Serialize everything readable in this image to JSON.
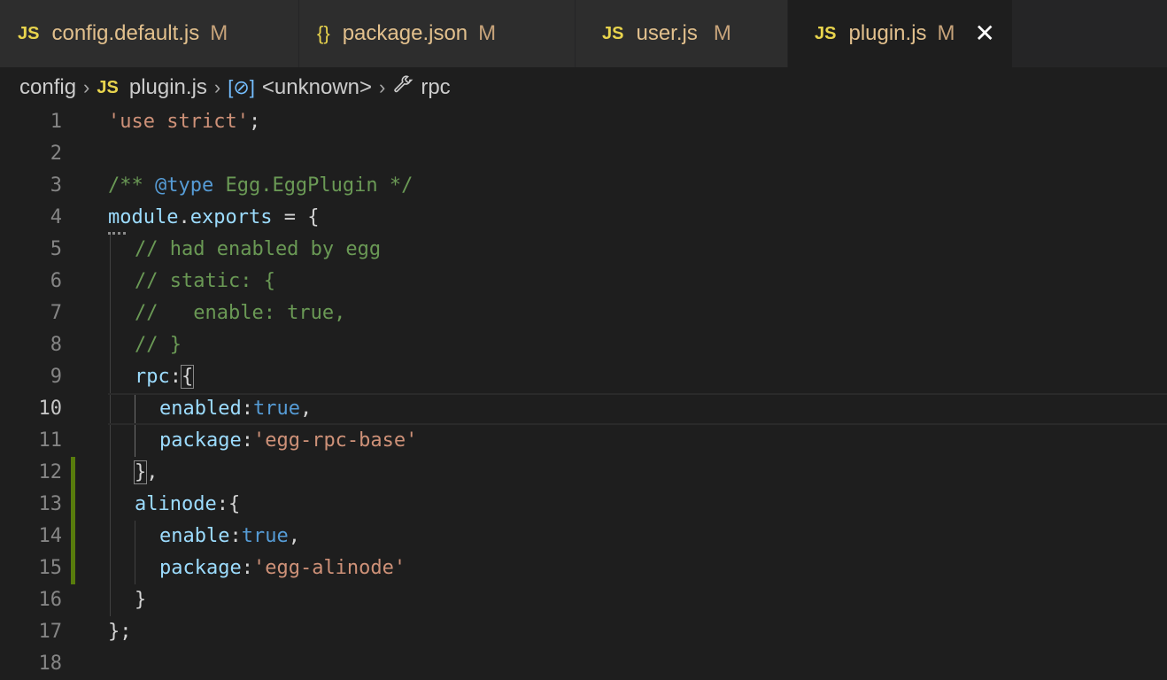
{
  "tabs": [
    {
      "icon": "JS",
      "name": "config.default.js",
      "modified": "M"
    },
    {
      "icon": "{}",
      "name": "package.json",
      "modified": "M"
    },
    {
      "icon": "JS",
      "name": "user.js",
      "modified": "M"
    },
    {
      "icon": "JS",
      "name": "plugin.js",
      "modified": "M",
      "close": "✕"
    }
  ],
  "breadcrumb": {
    "folder": "config",
    "file_icon": "JS",
    "file": "plugin.js",
    "symbol": "<unknown>",
    "member": "rpc"
  },
  "editor": {
    "line_numbers": [
      "1",
      "2",
      "3",
      "4",
      "5",
      "6",
      "7",
      "8",
      "9",
      "10",
      "11",
      "12",
      "13",
      "14",
      "15",
      "16",
      "17",
      "18"
    ],
    "active_line": "10",
    "lines": [
      {
        "t1": "'use strict'",
        "t2": ";"
      },
      {},
      {
        "t1": "/** ",
        "t2": "@type",
        "t3": " Egg.EggPlugin */"
      },
      {
        "t1": "module",
        "t2": ".",
        "t3": "exports",
        "t4": " = {"
      },
      {
        "t1": "// had enabled by egg"
      },
      {
        "t1": "// static: {"
      },
      {
        "t1": "//   enable: true,"
      },
      {
        "t1": "// }"
      },
      {
        "t1": "rpc",
        "t2": ":",
        "t3": "{"
      },
      {
        "t1": "enabled",
        "t2": ":",
        "t3": "true",
        "t4": ","
      },
      {
        "t1": "package",
        "t2": ":",
        "t3": "'egg-rpc-base'"
      },
      {
        "t1": "}",
        "t2": ","
      },
      {
        "t1": "alinode",
        "t2": ":",
        "t3": "{"
      },
      {
        "t1": "enable",
        "t2": ":",
        "t3": "true",
        "t4": ","
      },
      {
        "t1": "package",
        "t2": ":",
        "t3": "'egg-alinode'"
      },
      {
        "t1": "}"
      },
      {
        "t1": "};"
      },
      {}
    ]
  },
  "colors": {
    "background": "#1e1e1e",
    "string": "#ce9178",
    "comment": "#6a9955",
    "keyword": "#569cd6",
    "property": "#9cdcfe",
    "modified_gutter": "#587c0c"
  }
}
